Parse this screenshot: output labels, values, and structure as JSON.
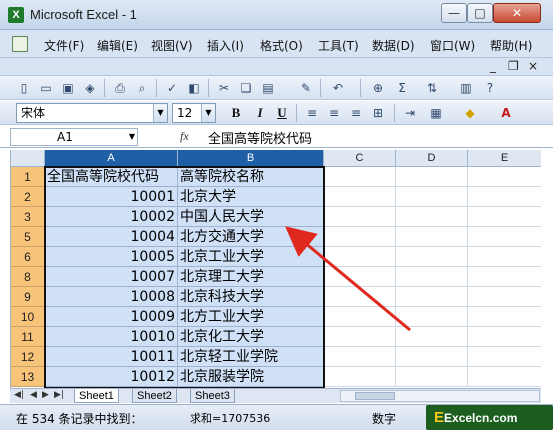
{
  "window": {
    "title": "Microsoft Excel - 1",
    "app_icon_glyph": "X",
    "buttons": {
      "minimize": "—",
      "maximize": "□",
      "close": "✕"
    }
  },
  "menu": {
    "items": [
      "文件(F)",
      "编辑(E)",
      "视图(V)",
      "插入(I)",
      "格式(O)",
      "工具(T)",
      "数据(D)",
      "窗口(W)",
      "帮助(H)"
    ],
    "mdi": {
      "minimize": "_",
      "restore": "❐",
      "close": "×"
    }
  },
  "toolbar": {
    "font_name": "宋体",
    "font_size": "12",
    "bold": "B",
    "italic": "I",
    "underline": "U"
  },
  "formula_bar": {
    "name_box": "A1",
    "fx": "fx",
    "content": "全国高等院校代码"
  },
  "grid": {
    "columns": [
      "A",
      "B",
      "C",
      "D",
      "E"
    ],
    "rows": [
      {
        "num": "1",
        "a": "全国高等院校代码",
        "b": "高等院校名称"
      },
      {
        "num": "2",
        "a": "10001",
        "b": "北京大学"
      },
      {
        "num": "3",
        "a": "10002",
        "b": "中国人民大学"
      },
      {
        "num": "5",
        "a": "10004",
        "b": "北方交通大学"
      },
      {
        "num": "6",
        "a": "10005",
        "b": "北京工业大学"
      },
      {
        "num": "8",
        "a": "10007",
        "b": "北京理工大学"
      },
      {
        "num": "9",
        "a": "10008",
        "b": "北京科技大学"
      },
      {
        "num": "10",
        "a": "10009",
        "b": "北方工业大学"
      },
      {
        "num": "11",
        "a": "10010",
        "b": "北京化工大学"
      },
      {
        "num": "12",
        "a": "10011",
        "b": "北京轻工业学院"
      },
      {
        "num": "13",
        "a": "10012",
        "b": "北京服装学院"
      }
    ]
  },
  "sheets": [
    "Sheet1",
    "Sheet2",
    "Sheet3"
  ],
  "status": {
    "message": "在 534 条记录中找到：",
    "sum": "求和=1707536",
    "mode": "数字"
  },
  "watermark": {
    "e": "E",
    "text": "Excelcn.com"
  },
  "colors": {
    "selection": "#cfe0f7",
    "row_header": "#f7c479",
    "arrow": "#e0281f"
  }
}
